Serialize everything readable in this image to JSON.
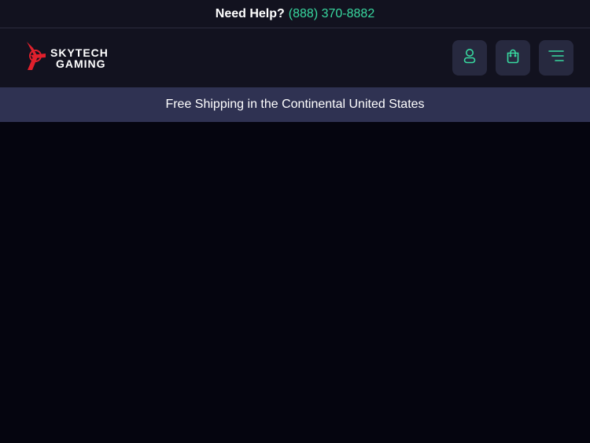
{
  "topbar": {
    "help_label": "Need Help?",
    "phone": "(888) 370-8882"
  },
  "header": {
    "logo": {
      "line1": "SKYTECH",
      "line2": "GAMING"
    },
    "icons": [
      "user-icon",
      "shopping-bag-icon",
      "menu-icon"
    ]
  },
  "promo": {
    "text": "Free Shipping in the Continental United States"
  },
  "colors": {
    "accent": "#38d9a0",
    "brand_red": "#e0202c",
    "header_bg": "#12121f",
    "promo_bg": "#2f3252",
    "page_bg": "#05050f"
  }
}
